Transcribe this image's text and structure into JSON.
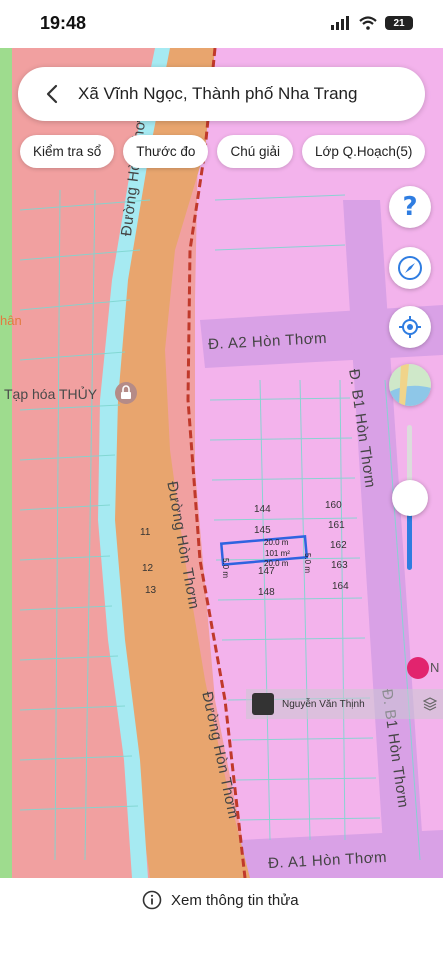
{
  "status_bar": {
    "time": "19:48",
    "battery": "21"
  },
  "search": {
    "title": "Xã Vĩnh Ngọc, Thành phố Nha Trang"
  },
  "chips": [
    {
      "label": "Kiểm tra sổ"
    },
    {
      "label": "Thước đo"
    },
    {
      "label": "Chú giải"
    },
    {
      "label": "Lớp Q.Hoạch(5)"
    }
  ],
  "map": {
    "poi_shop": "Tạp hóa THỦY",
    "poi_cut": "hân",
    "poi_cut_right": "N",
    "roads": {
      "hon_thom_1": "Đường Hòn Thơm",
      "hon_thom_2": "Đường Hòn Thơm",
      "hon_thom_3": "Đường Hòn Thơm",
      "a2": "Đ. A2 Hòn Thơm",
      "a1": "Đ. A1 Hòn Thơm",
      "b1_1": "Đ. B1 Hòn Thơm",
      "b1_2": "Đ. B1 Hòn Thơm"
    },
    "parcels": {
      "p144": "144",
      "p145": "145",
      "p147": "147",
      "p148": "148",
      "p160": "160",
      "p161": "161",
      "p162": "162",
      "p163": "163",
      "p164": "164",
      "p11": "11",
      "p12": "12",
      "p13": "13"
    },
    "selected_parcel": {
      "width_top": "20.0 m",
      "area": "101 m²",
      "width_bottom": "20.0 m",
      "depth_left": "5.0 m",
      "depth_right": "5.0 m"
    },
    "owner_name": "Nguyễn Văn Thịnh",
    "colors": {
      "rural_residential": "#f1a0a0",
      "urban_residential": "#f3b3ec",
      "road": "#e8a56e",
      "road_internal": "#d9a1e6",
      "river": "#a6eaf2",
      "selected_outline": "#2f63e0"
    }
  },
  "controls": {
    "zoom_slider_fraction": 0.55
  },
  "bottom": {
    "info_label": "Xem thông tin thửa"
  }
}
